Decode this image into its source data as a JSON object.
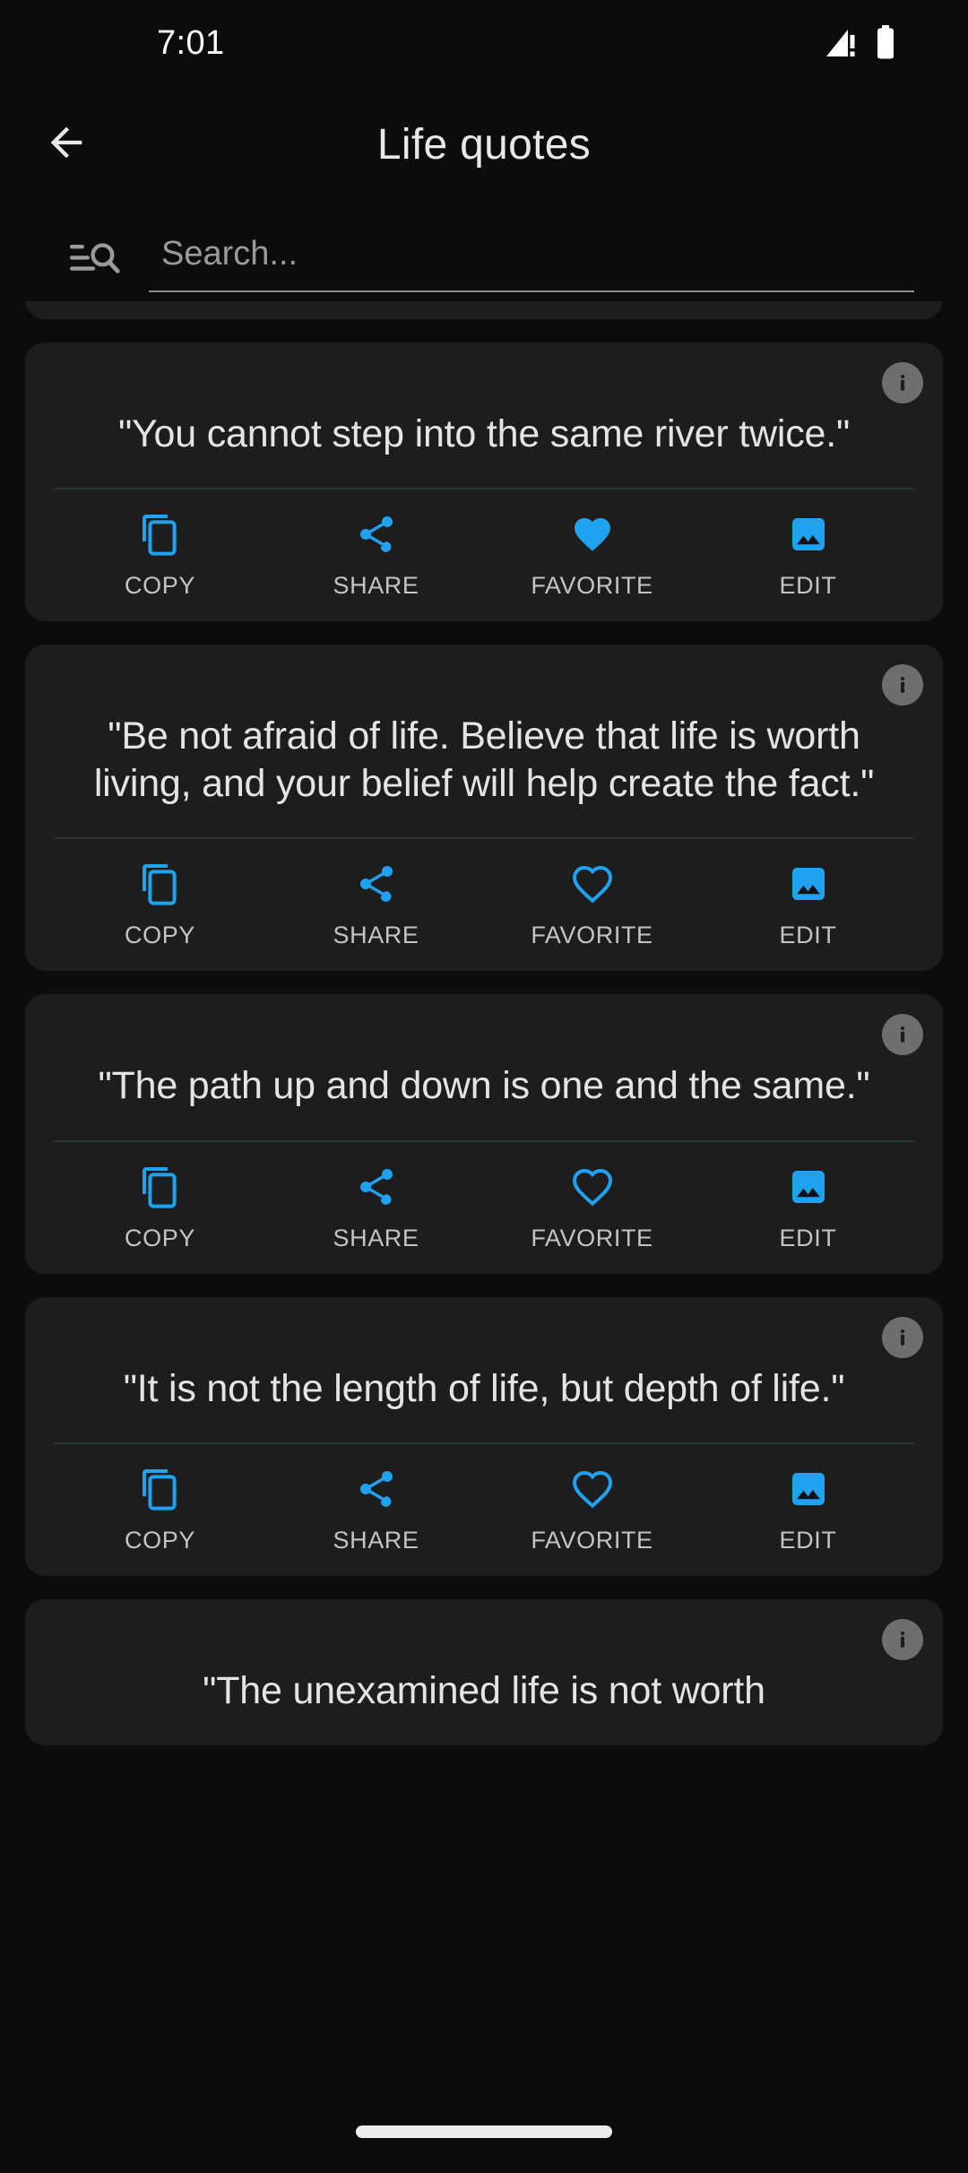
{
  "status_bar": {
    "time": "7:01",
    "signal_icon": "cell-signal-alert-icon",
    "battery_icon": "battery-full-icon"
  },
  "app_bar": {
    "back_icon": "arrow-back-icon",
    "title": "Life quotes"
  },
  "search": {
    "icon": "manage-search-icon",
    "placeholder": "Search...",
    "value": ""
  },
  "colors": {
    "accent": "#1fa2f0",
    "background": "#0c0c0c",
    "card": "#1d1d1d",
    "text_primary": "#e4e4e4",
    "text_secondary": "#c4c4c4",
    "divider": "#2b3534",
    "info_badge": "#6e6e6e"
  },
  "action_labels": {
    "copy": "COPY",
    "share": "SHARE",
    "favorite": "FAVORITE",
    "edit": "EDIT"
  },
  "action_icons": {
    "copy": "copy-icon",
    "share": "share-icon",
    "favorite": "heart-icon",
    "edit": "image-icon"
  },
  "info_icon": "info-icon",
  "cards": [
    {
      "text": "",
      "favorited": false,
      "clipped": "top"
    },
    {
      "text": "\"You cannot step into the same river twice.\"",
      "favorited": true,
      "clipped": "none"
    },
    {
      "text": "\"Be not afraid of life. Believe that life is worth living, and your belief will help create the fact.\"",
      "favorited": false,
      "clipped": "none"
    },
    {
      "text": "\"The path up and down is one and the same.\"",
      "favorited": false,
      "clipped": "none"
    },
    {
      "text": "\"It is not the length of life, but depth of life.\"",
      "favorited": false,
      "clipped": "none"
    },
    {
      "text": "\"The unexamined life is not worth",
      "favorited": false,
      "clipped": "bottom"
    }
  ],
  "nav_bar": {
    "home_indicator": "home-indicator"
  }
}
